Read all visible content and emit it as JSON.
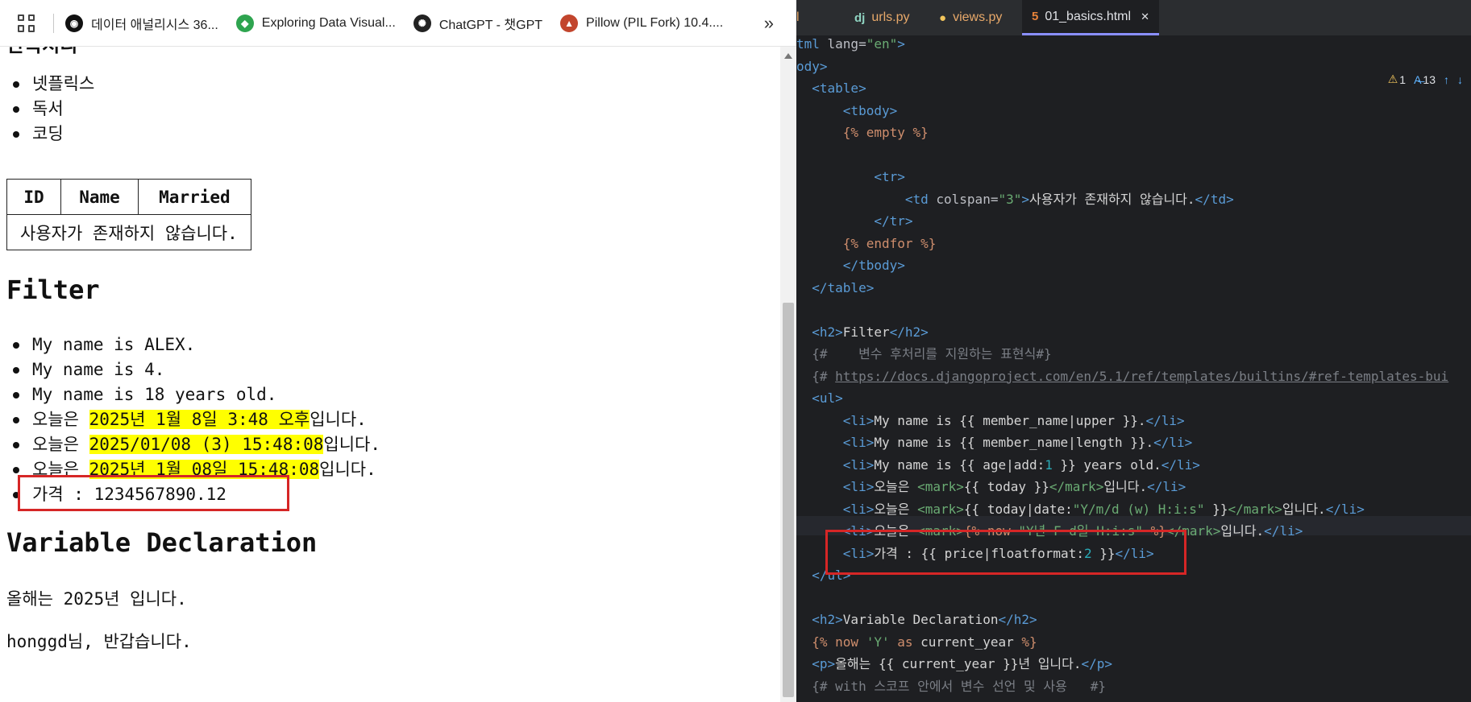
{
  "bookmarks": [
    {
      "label": "데이터 애널리시스 36...",
      "icon": "github-icon",
      "color": "#111111"
    },
    {
      "label": "Exploring Data Visual...",
      "icon": "diamond-logo-icon",
      "color": "#2ea44f"
    },
    {
      "label": "ChatGPT - 챗GPT",
      "icon": "openai-icon",
      "color": "#222222"
    },
    {
      "label": "Pillow (PIL Fork) 10.4....",
      "icon": "python-logo-icon",
      "color": "#c2452d"
    }
  ],
  "page": {
    "hobby_heading": "반복처리",
    "hobbies": [
      "넷플릭스",
      "독서",
      "코딩"
    ],
    "table": {
      "headers": [
        "ID",
        "Name",
        "Married"
      ],
      "empty_row": "사용자가 존재하지 않습니다."
    },
    "filter_heading": "Filter",
    "filter_items": [
      {
        "before": "My name is ALEX.",
        "mark": "",
        "after": ""
      },
      {
        "before": "My name is 4.",
        "mark": "",
        "after": ""
      },
      {
        "before": "My name is 18 years old.",
        "mark": "",
        "after": ""
      },
      {
        "before": "오늘은 ",
        "mark": "2025년 1월 8일 3:48 오후",
        "after": "입니다."
      },
      {
        "before": "오늘은 ",
        "mark": "2025/01/08 (3) 15:48:08",
        "after": "입니다."
      },
      {
        "before": "오늘은 ",
        "mark": "2025년 1월 08일 15:48:08",
        "after": "입니다."
      },
      {
        "before": "가격 : 1234567890.12",
        "mark": "",
        "after": ""
      }
    ],
    "var_heading": "Variable Declaration",
    "year_text": "올해는 2025년 입니다.",
    "greet_text": "honggd님, 반갑습니다."
  },
  "editor": {
    "tabs": [
      {
        "label": "l",
        "icon": ""
      },
      {
        "label": "urls.py",
        "icon": "dj"
      },
      {
        "label": "views.py",
        "icon": "python-icon"
      },
      {
        "label": "01_basics.html",
        "icon": "html5-icon"
      }
    ],
    "warnings": "1",
    "typos": "13",
    "code_lines": [
      [
        [
          "tg",
          "tml "
        ],
        [
          "at",
          "lang="
        ],
        [
          "av",
          "\"en\""
        ],
        [
          "tg",
          ">"
        ]
      ],
      [
        [
          "tg",
          "ody>"
        ]
      ],
      [
        [
          "tg",
          "  <table>"
        ]
      ],
      [
        [
          "tg",
          "      <tbody>"
        ]
      ],
      [
        [
          "tm",
          "      {% empty %}"
        ]
      ],
      [
        [
          "tx",
          ""
        ]
      ],
      [
        [
          "tg",
          "          <tr>"
        ]
      ],
      [
        [
          "tg",
          "              <td "
        ],
        [
          "at",
          "colspan="
        ],
        [
          "av",
          "\"3\""
        ],
        [
          "tg",
          ">"
        ],
        [
          "tx",
          "사용자가 존재하지 않습니다."
        ],
        [
          "tg",
          "</td>"
        ]
      ],
      [
        [
          "tg",
          "          </tr>"
        ]
      ],
      [
        [
          "tm",
          "      {% endfor %}"
        ]
      ],
      [
        [
          "tg",
          "      </tbody>"
        ]
      ],
      [
        [
          "tg",
          "  </table>"
        ]
      ],
      [
        [
          "tx",
          ""
        ]
      ],
      [
        [
          "tg",
          "  <h2>"
        ],
        [
          "tx",
          "Filter"
        ],
        [
          "tg",
          "</h2>"
        ]
      ],
      [
        [
          "cm",
          "  {#    변수 후처리를 지원하는 표현식#}"
        ]
      ],
      [
        [
          "cm",
          "  {# "
        ],
        [
          "lk",
          "https://docs.djangoproject.com/en/5.1/ref/templates/builtins/#ref-templates-bui"
        ]
      ],
      [
        [
          "tg",
          "  <ul>"
        ]
      ],
      [
        [
          "tg",
          "      <li>"
        ],
        [
          "tx",
          "My name is {{ member_name|upper }}."
        ],
        [
          "tg",
          "</li>"
        ]
      ],
      [
        [
          "tg",
          "      <li>"
        ],
        [
          "tx",
          "My name is {{ member_name|length }}."
        ],
        [
          "tg",
          "</li>"
        ]
      ],
      [
        [
          "tg",
          "      <li>"
        ],
        [
          "tx",
          "My name is {{ age|add:"
        ],
        [
          "nu",
          "1"
        ],
        [
          "tx",
          " }} years old."
        ],
        [
          "tg",
          "</li>"
        ]
      ],
      [
        [
          "tg",
          "      <li>"
        ],
        [
          "tx",
          "오늘은 "
        ],
        [
          "av",
          "<mark>"
        ],
        [
          "tx",
          "{{ today }}"
        ],
        [
          "av",
          "</mark>"
        ],
        [
          "tx",
          "입니다."
        ],
        [
          "tg",
          "</li>"
        ]
      ],
      [
        [
          "tg",
          "      <li>"
        ],
        [
          "tx",
          "오늘은 "
        ],
        [
          "av",
          "<mark>"
        ],
        [
          "tx",
          "{{ today|date:"
        ],
        [
          "av",
          "\"Y/m/d (w) H:i:s\""
        ],
        [
          "tx",
          " }}"
        ],
        [
          "av",
          "</mark>"
        ],
        [
          "tx",
          "입니다."
        ],
        [
          "tg",
          "</li>"
        ]
      ],
      [
        [
          "tg",
          "      <li>"
        ],
        [
          "tx",
          "오늘은 "
        ],
        [
          "av",
          "<mark>"
        ],
        [
          "tm",
          "{% now "
        ],
        [
          "av",
          "\"Y년 F d일 H:i:s\""
        ],
        [
          "tm",
          " %}"
        ],
        [
          "av",
          "</mark>"
        ],
        [
          "tx",
          "입니다."
        ],
        [
          "tg",
          "</li>"
        ]
      ],
      [
        [
          "tg",
          "      <li>"
        ],
        [
          "tx",
          "가격 : {{ price|floatformat:"
        ],
        [
          "nu",
          "2"
        ],
        [
          "tx",
          " }}"
        ],
        [
          "tg",
          "</li>"
        ]
      ],
      [
        [
          "tg",
          "  </ul>"
        ]
      ],
      [
        [
          "tx",
          ""
        ]
      ],
      [
        [
          "tg",
          "  <h2>"
        ],
        [
          "tx",
          "Variable Declaration"
        ],
        [
          "tg",
          "</h2>"
        ]
      ],
      [
        [
          "tm",
          "  {% now "
        ],
        [
          "av",
          "'Y'"
        ],
        [
          "tm",
          " as "
        ],
        [
          "tx",
          "current_year "
        ],
        [
          "tm",
          "%}"
        ]
      ],
      [
        [
          "tg",
          "  <p>"
        ],
        [
          "tx",
          "올해는 {{ current_year }}년 입니다."
        ],
        [
          "tg",
          "</p>"
        ]
      ],
      [
        [
          "cm",
          "  {# with 스코프 안에서 변수 선언 및 사용   #}"
        ]
      ]
    ]
  }
}
